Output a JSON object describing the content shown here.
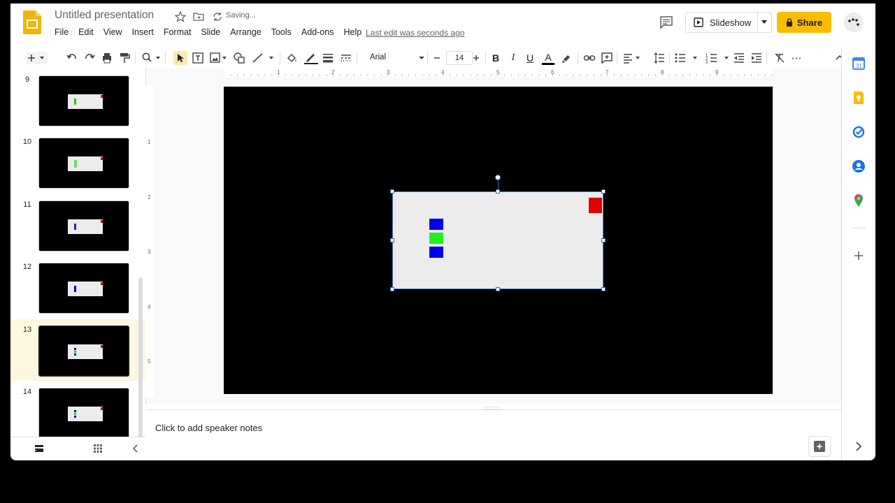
{
  "header": {
    "doc_title": "Untitled presentation",
    "saving_status": "Saving...",
    "last_edit": "Last edit was seconds ago",
    "slideshow_label": "Slideshow",
    "share_label": "Share"
  },
  "menu": [
    "File",
    "Edit",
    "View",
    "Insert",
    "Format",
    "Slide",
    "Arrange",
    "Tools",
    "Add-ons",
    "Help"
  ],
  "toolbar": {
    "font_name": "Arial",
    "font_size": "14",
    "bold": "B",
    "italic": "I",
    "underline": "U",
    "text_color": "A",
    "more": "⋯"
  },
  "filmstrip": {
    "slides": [
      {
        "number": "9",
        "inner_color": "#2dbf2d"
      },
      {
        "number": "10",
        "inner_color": "#66e066"
      },
      {
        "number": "11",
        "inner_color": "#2222cc"
      },
      {
        "number": "12",
        "inner_color": "#0000cc"
      },
      {
        "number": "13",
        "inner_color": "#0000cc",
        "selected": true
      },
      {
        "number": "14",
        "inner_color": "#2dbf2d"
      }
    ]
  },
  "ruler": {
    "top": [
      "1",
      "2",
      "3",
      "4",
      "5",
      "6",
      "7",
      "8",
      "9"
    ],
    "left": [
      "1",
      "2",
      "3",
      "4",
      "5"
    ]
  },
  "slide": {
    "background": "#000000",
    "box_color": "#ececec",
    "squares": [
      {
        "color": "#0000ee"
      },
      {
        "color": "#22ee22"
      },
      {
        "color": "#0000ee"
      },
      {
        "color": "#dd0000"
      }
    ]
  },
  "notes": {
    "placeholder": "Click to add speaker notes"
  },
  "colors": {
    "accent": "#fbbc04",
    "selection": "#2b6cc4",
    "brand": "#f4b400"
  }
}
